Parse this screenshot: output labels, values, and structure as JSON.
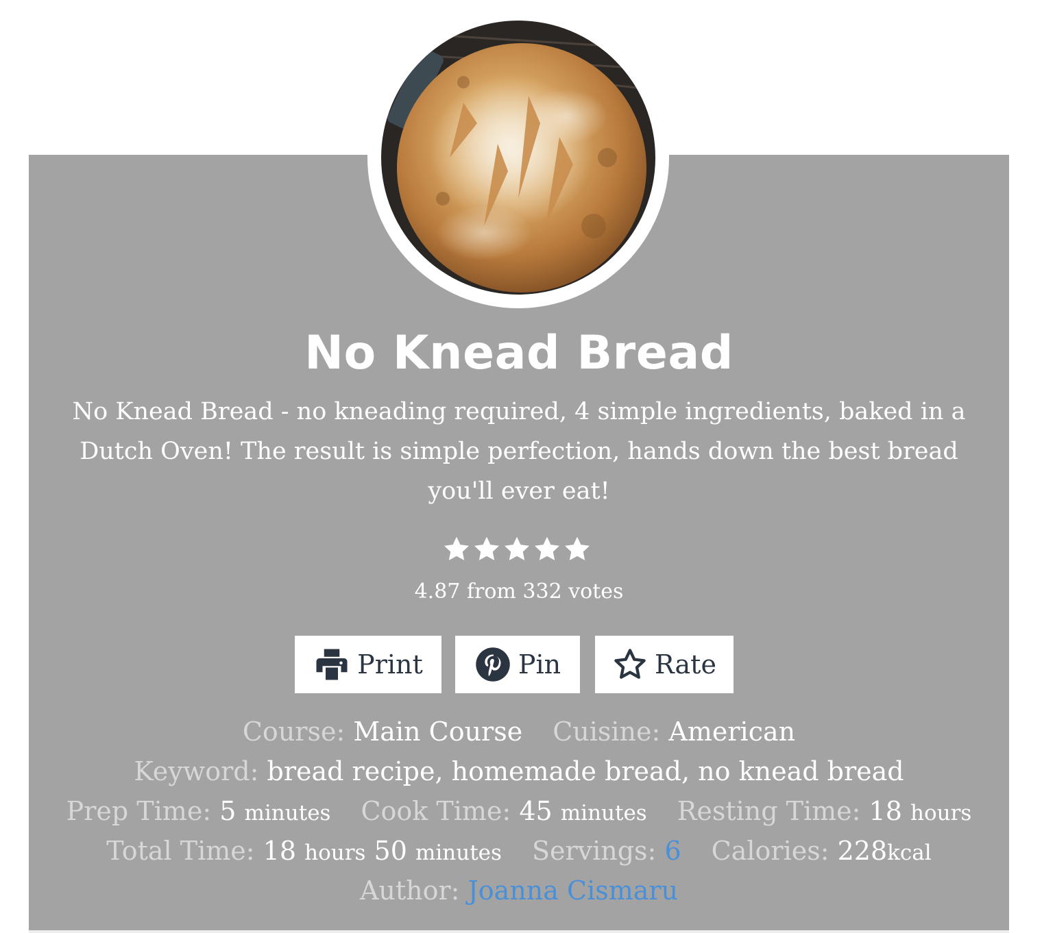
{
  "recipe": {
    "title": "No Knead Bread",
    "summary": "No Knead Bread - no kneading required, 4 simple ingredients, baked in a Dutch Oven! The result is simple perfection, hands down the best bread you'll ever eat!",
    "image_icon": "bread-loaf-photo",
    "rating_value": 4.87,
    "rating_text": "4.87 from 332 votes",
    "stars_filled": 5
  },
  "buttons": {
    "print": "Print",
    "pin": "Pin",
    "rate": "Rate"
  },
  "meta": {
    "course_label": "Course:",
    "course_value": "Main Course",
    "cuisine_label": "Cuisine:",
    "cuisine_value": "American",
    "keyword_label": "Keyword:",
    "keyword_value": "bread recipe, homemade bread, no knead bread",
    "prep_label": "Prep Time:",
    "prep_num": "5",
    "prep_unit": "minutes",
    "cook_label": "Cook Time:",
    "cook_num": "45",
    "cook_unit": "minutes",
    "rest_label": "Resting Time:",
    "rest_num": "18",
    "rest_unit": "hours",
    "total_label": "Total Time:",
    "total_num1": "18",
    "total_unit1": "hours",
    "total_num2": "50",
    "total_unit2": "minutes",
    "servings_label": "Servings:",
    "servings_value": "6",
    "calories_label": "Calories:",
    "calories_num": "228",
    "calories_unit": "kcal",
    "author_label": "Author:",
    "author_value": "Joanna Cismaru"
  },
  "colors": {
    "card_bg": "#a3a3a3",
    "link": "#4a90d9",
    "label": "#d7d7d7",
    "button_text": "#2b3441"
  }
}
